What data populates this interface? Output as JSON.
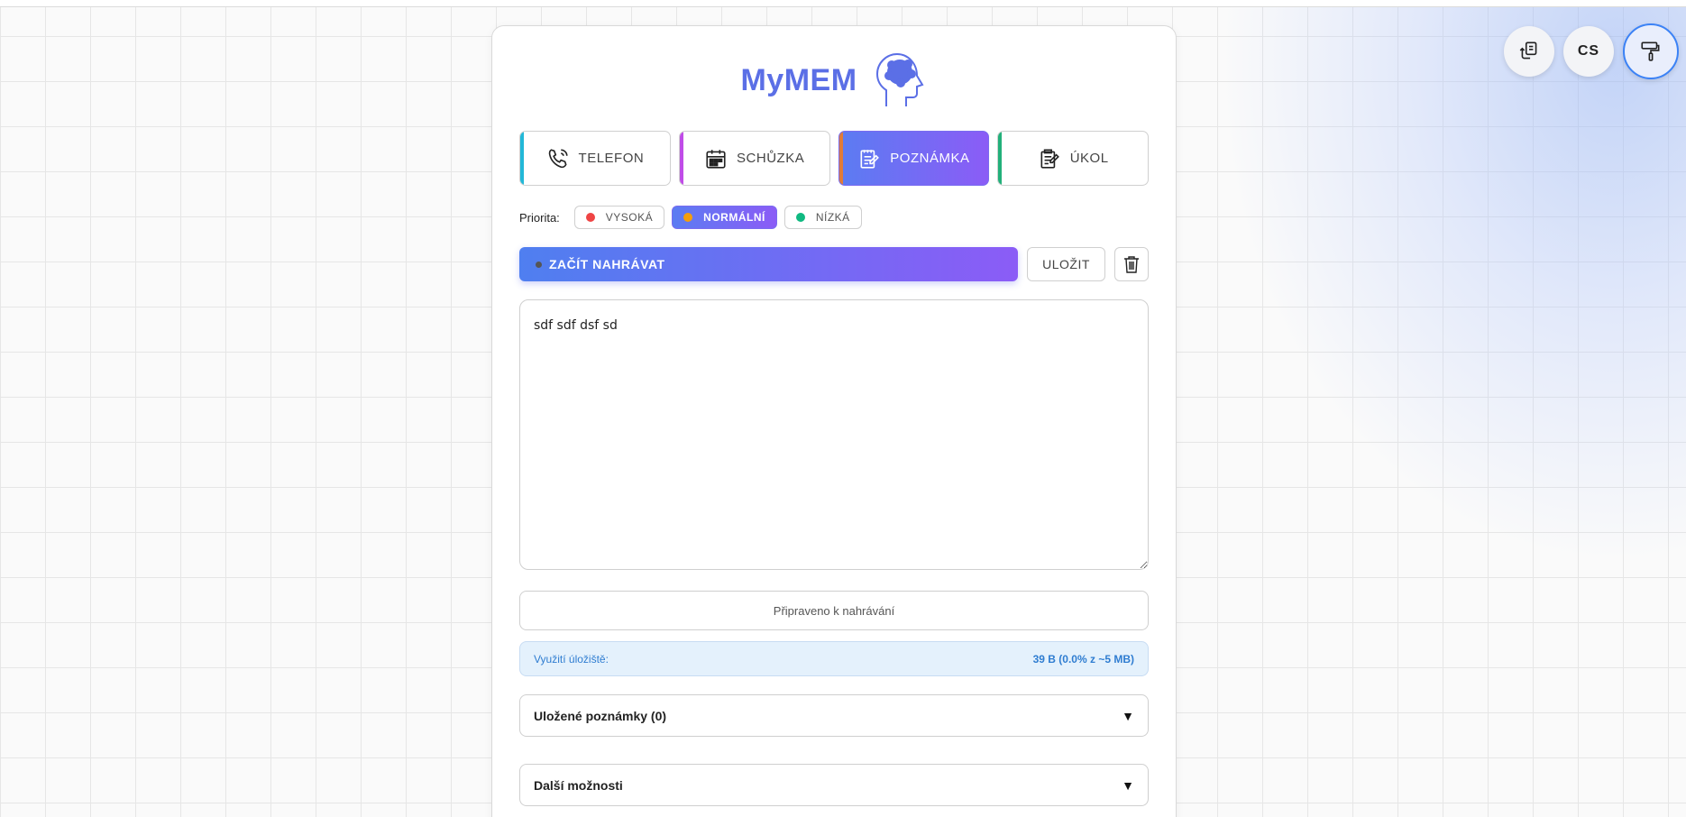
{
  "brand": {
    "title": "MyMEM"
  },
  "corner": {
    "language": "CS"
  },
  "types": [
    {
      "label": "TELEFON",
      "icon": "phone-icon",
      "color": "#22b8d8"
    },
    {
      "label": "SCHŮZKA",
      "icon": "calendar-icon",
      "color": "#c04ce8"
    },
    {
      "label": "POZNÁMKA",
      "icon": "note-icon",
      "color": "#e07b39",
      "active": true
    },
    {
      "label": "ÚKOL",
      "icon": "task-icon",
      "color": "#22b07a"
    }
  ],
  "priority": {
    "label": "Priorita:",
    "options": [
      {
        "label": "VYSOKÁ",
        "color": "#ef4444"
      },
      {
        "label": "NORMÁLNÍ",
        "color": "#f59e0b",
        "active": true
      },
      {
        "label": "NÍZKÁ",
        "color": "#10b981"
      }
    ]
  },
  "record": {
    "start_label": "ZAČÍT NAHRÁVAT",
    "save_label": "ULOŽIT"
  },
  "note": {
    "text": "sdf sdf dsf sd"
  },
  "status": {
    "text": "Připraveno k nahrávání"
  },
  "storage": {
    "label": "Využití úložiště:",
    "value": "39 B (0.0% z ~5 MB)"
  },
  "sections": {
    "saved_notes": "Uložené poznámky (0)",
    "more_options": "Další možnosti",
    "arrow": "▼"
  },
  "colors": {
    "accent_start": "#4f7ff0",
    "accent_end": "#8b5cf6",
    "brand": "#5b6fe6"
  }
}
